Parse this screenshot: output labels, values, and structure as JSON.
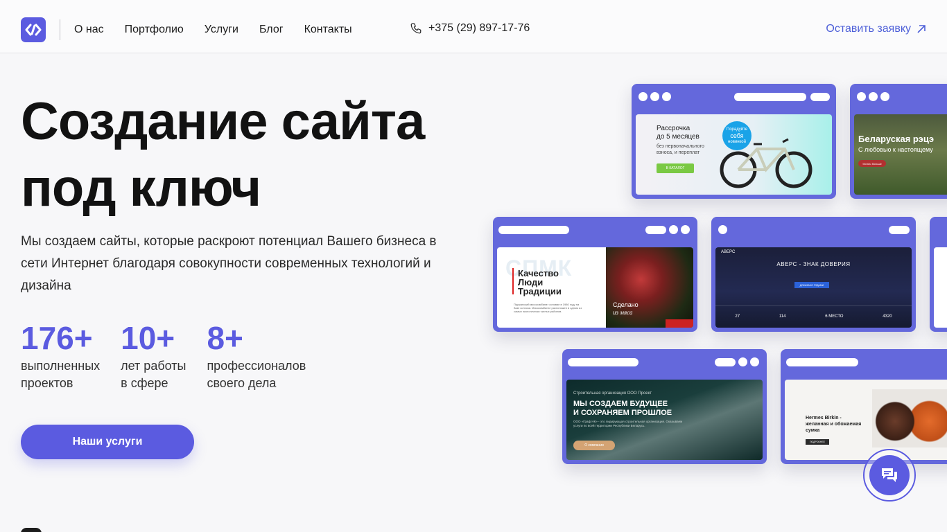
{
  "header": {
    "nav": [
      "О нас",
      "Портфолио",
      "Услуги",
      "Блог",
      "Контакты"
    ],
    "phone": "+375 (29) 897-17-76",
    "cta": "Оставить заявку"
  },
  "hero": {
    "title_line1": "Создание сайта",
    "title_line2": "под ключ",
    "description": "Мы создаем сайты, которые раскроют потенциал Вашего бизнеса в сети Интернет благодаря совокупности современных технологий и дизайна",
    "stats": [
      {
        "value": "176+",
        "label1": "выполненных",
        "label2": "проектов"
      },
      {
        "value": "10+",
        "label1": "лет работы",
        "label2": "в сфере"
      },
      {
        "value": "8+",
        "label1": "профессионалов",
        "label2": "своего дела"
      }
    ],
    "button": "Наши услуги"
  },
  "portfolio": {
    "bike": {
      "title1": "Рассрочка",
      "title2": "до 5 месяцев",
      "sub1": "без первоначального",
      "sub2": "взноса, и переплат",
      "badge1": "Порадуйте",
      "badge2": "себя",
      "badge3": "новинкой",
      "btn": "В КАТАЛОГ"
    },
    "belarus": {
      "title": "Беларуская рэцэ",
      "sub": "С любовью к настоящему",
      "btn": "Узнать больше"
    },
    "meat": {
      "bg": "СПМК",
      "title1": "Качество",
      "title2": "Люди",
      "title3": "Традиции",
      "desc": "Пружанский мясокомбинат основан в 1980 году на базе колхоза. Мясокомбинат расположен в одном из самых экологически чистых районов.",
      "made1": "Сделано",
      "made2": "из мяса"
    },
    "avers": {
      "logo": "АВЕРС",
      "title": "АВЕРС - ЗНАК ДОВЕРИЯ",
      "btn": "ДОКАЗАНО ГОДАМИ",
      "stats": [
        "27",
        "114",
        "6 МЕСТО",
        "4320"
      ]
    },
    "construct": {
      "kicker": "Строительная организация ООО Проект",
      "title1": "МЫ СОЗДАЕМ БУДУЩЕЕ",
      "title2": "И СОХРАНЯЕМ ПРОШЛОЕ",
      "desc": "ООО «Граф НК» - это лидирующая строительная организация. Оказываем услуги по всей территории Республики Беларусь.",
      "btn": "О компании"
    },
    "hermes": {
      "title1": "Hermes Birkin -",
      "title2": "желанная и обожаемая",
      "title3": "сумка",
      "btn": "ПОДРОБНЕЕ"
    }
  },
  "colors": {
    "accent": "#5b5be0",
    "card": "#6468dc"
  }
}
